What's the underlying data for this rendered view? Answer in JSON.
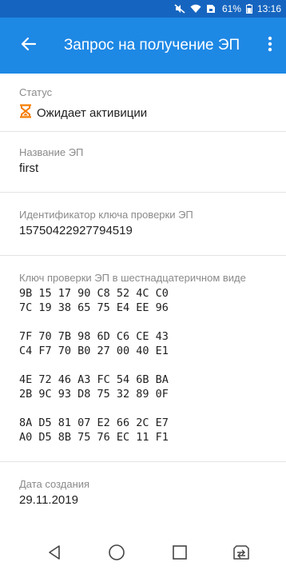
{
  "statusbar": {
    "battery_percent": "61%",
    "time": "13:16",
    "icons": [
      "mute-icon",
      "wifi-icon",
      "sim-icon",
      "battery-icon"
    ]
  },
  "appbar": {
    "title": "Запрос на получение ЭП",
    "back_icon": "arrow-left-icon",
    "menu_icon": "more-vert-icon",
    "color": "#1e88e5",
    "statusbar_color": "#1565c0"
  },
  "sections": {
    "status": {
      "label": "Статус",
      "value": "Ожидает активиции",
      "icon": "hourglass-icon",
      "icon_color": "#f57c00"
    },
    "name": {
      "label": "Название ЭП",
      "value": "first"
    },
    "key_id": {
      "label": "Идентификатор ключа проверки ЭП",
      "value": "15750422927794519"
    },
    "key_hex": {
      "label": "Ключ проверки ЭП в шестнадцатеричном виде",
      "blocks": [
        [
          "9B 15 17 90 C8 52 4C C0",
          "7C 19 38 65 75 E4 EE 96"
        ],
        [
          "7F 70 7B 98 6D C6 CE 43",
          "C4 F7 70 B0 27 00 40 E1"
        ],
        [
          "4E 72 46 A3 FC 54 6B BA",
          "2B 9C 93 D8 75 32 89 0F"
        ],
        [
          "8A D5 81 07 E2 66 2C E7",
          "A0 D5 8B 75 76 EC 11 F1"
        ]
      ]
    },
    "created": {
      "label": "Дата создания",
      "value": "29.11.2019"
    }
  },
  "navbar": {
    "icons": [
      "back-triangle-icon",
      "home-circle-icon",
      "recents-square-icon",
      "switch-sim-icon"
    ]
  }
}
